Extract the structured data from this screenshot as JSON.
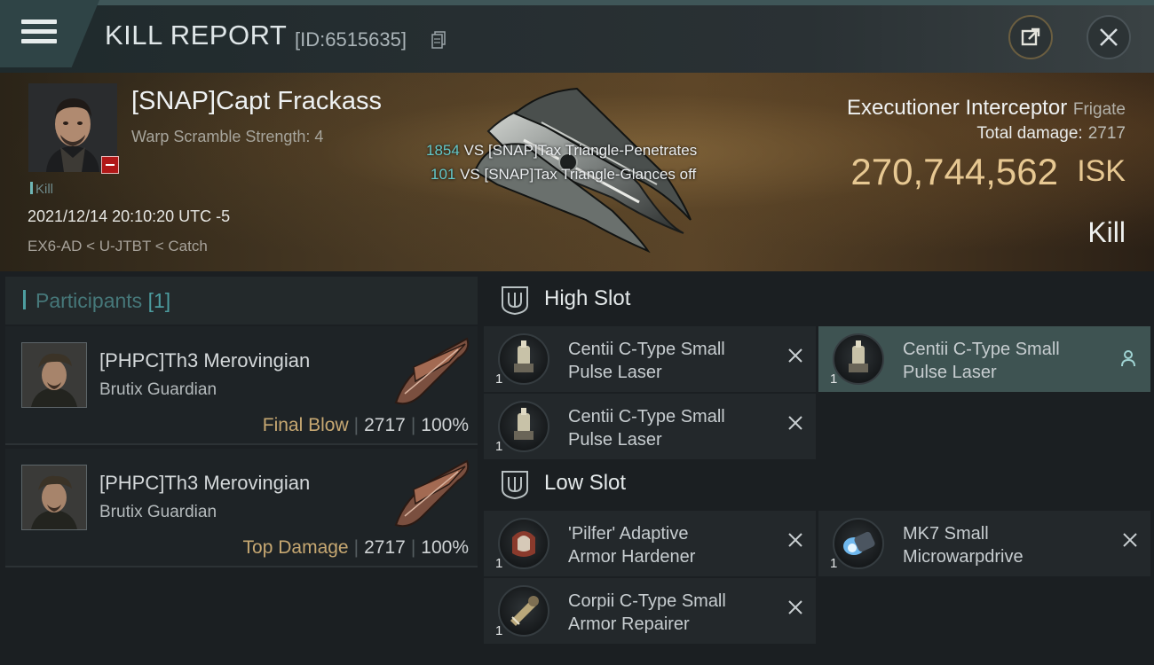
{
  "header": {
    "title": "KILL REPORT",
    "report_id": "[ID:6515635]",
    "menu_icon": "hamburger-icon",
    "share_icon": "share-icon",
    "close_icon": "close-icon"
  },
  "victim": {
    "name": "[SNAP]Capt Frackass",
    "warp_scramble": "Warp Scramble Strength: 4",
    "tag": "Kill",
    "datetime": "2021/12/14 20:10:20 UTC -5",
    "location": "EX6-AD < U-JTBT < Catch",
    "ship_name": "Executioner Interceptor",
    "ship_class": "Frigate",
    "total_damage_label": "Total damage:",
    "total_damage_value": "2717",
    "isk_value": "270,744,562",
    "isk_unit": "ISK",
    "result": "Kill"
  },
  "hits": [
    {
      "count": "1854",
      "text": " VS [SNAP]Tax Triangle-Penetrates"
    },
    {
      "count": "101",
      "text": " VS [SNAP]Tax Triangle-Glances off"
    }
  ],
  "participants": {
    "title": "Participants ",
    "count": "[1]",
    "cards": [
      {
        "name": "[PHPC]Th3 Merovingian",
        "ship": "Brutix Guardian",
        "tag": "Final Blow",
        "damage": "2717",
        "percent": "100%"
      },
      {
        "name": "[PHPC]Th3 Merovingian",
        "ship": "Brutix Guardian",
        "tag": "Top Damage",
        "damage": "2717",
        "percent": "100%"
      }
    ]
  },
  "high_slot": {
    "title": "High Slot",
    "modules": [
      {
        "line1": "Centii C-Type Small",
        "line2": "Pulse Laser",
        "qty": "1"
      },
      {
        "line1": "Centii C-Type Small",
        "line2": "Pulse Laser",
        "qty": "1"
      },
      {
        "line1": "Centii C-Type Small",
        "line2": "Pulse Laser",
        "qty": "1"
      }
    ]
  },
  "low_slot": {
    "title": "Low Slot",
    "modules": [
      {
        "line1": "'Pilfer' Adaptive",
        "line2": "Armor Hardener",
        "qty": "1"
      },
      {
        "line1": "MK7 Small",
        "line2": "Microwarpdrive",
        "qty": "1"
      },
      {
        "line1": "Corpii C-Type Small",
        "line2": "Armor Repairer",
        "qty": "1"
      }
    ]
  },
  "colors": {
    "accent_teal": "#63c7c9",
    "isk_gold": "#e7c892",
    "tag_gold": "#c7a872",
    "selected_bg": "#3e5352"
  }
}
